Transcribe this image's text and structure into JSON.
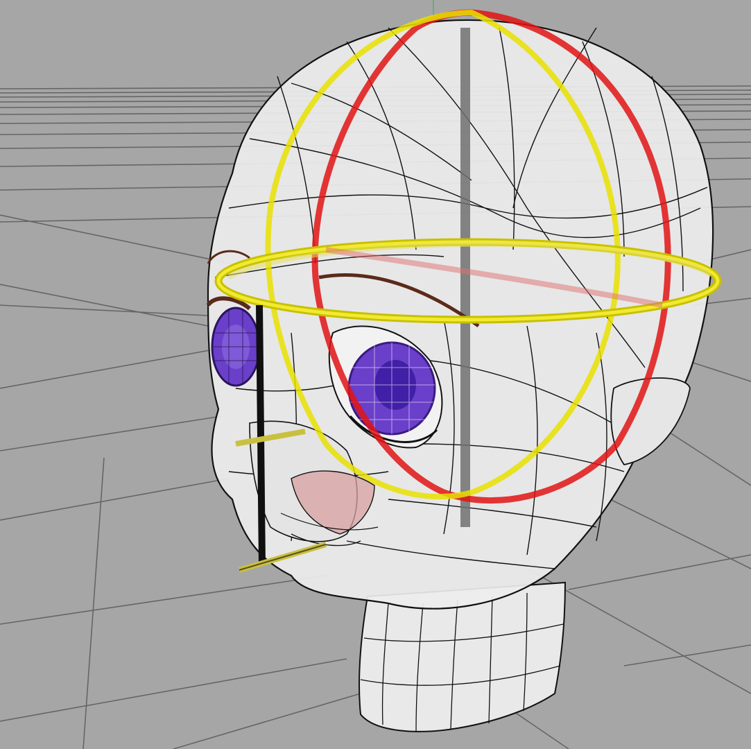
{
  "viewport": {
    "view": "perspective",
    "display_mode": "wireframe-shaded",
    "background_color": "#a6a6a6",
    "grid_color": "#5a5a5a",
    "axis_y_color": "#3fb060"
  },
  "model": {
    "object": "head",
    "mesh_color": "#ffffff",
    "wire_color": "#101010",
    "eye_iris_color": "#6a3fc9",
    "eyebrow_color": "#5a2a1a",
    "mouth_color": "#d8a0a0"
  },
  "rig": {
    "horizontal_ring_color": "#e8e000",
    "vertical_ring_x_color": "#e01414",
    "vertical_ring_z_color": "#e8e000",
    "center_axis_color": "#707070",
    "jaw_bone_color": "#101010",
    "jaw_pin_color": "#c8c040"
  }
}
